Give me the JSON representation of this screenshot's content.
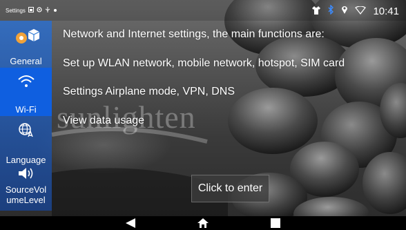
{
  "status_bar": {
    "app_label": "Settings",
    "time": "10:41",
    "icons": [
      "image-icon",
      "sync-icon",
      "usb-icon",
      "dot-icon",
      "tshirt-icon",
      "bluetooth-icon",
      "location-icon",
      "wifi-signal-icon"
    ]
  },
  "sidebar": {
    "items": [
      {
        "label": "General",
        "icon": "general-icon",
        "active": false
      },
      {
        "label": "Wi-Fi",
        "icon": "wifi-icon",
        "active": true
      },
      {
        "label": "Language",
        "icon": "globe-language-icon",
        "active": false
      },
      {
        "label": "SourceVol\numeLevel",
        "icon": "volume-icon",
        "active": false
      }
    ]
  },
  "main": {
    "lines": [
      "Network and Internet settings, the main functions are:",
      "Set up WLAN network, mobile network, hotspot, SIM card",
      "Settings Airplane mode, VPN, DNS",
      "View data usage"
    ],
    "enter_button": "Click to enter",
    "watermark": "sunlighten"
  },
  "nav_bar": {
    "buttons": [
      "back-icon",
      "home-icon",
      "recents-icon"
    ]
  },
  "colors": {
    "sidebar_bg": "#2f7ad6",
    "active_item": "#0f5fe0",
    "text": "#ffffff"
  }
}
